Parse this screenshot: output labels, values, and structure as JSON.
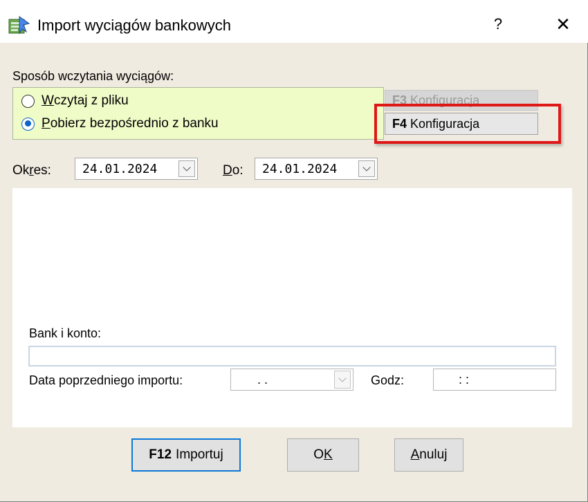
{
  "window": {
    "title": "Import wyciągów bankowych",
    "help_glyph": "?",
    "close_glyph": "✕"
  },
  "mode": {
    "section_label": "Sposób wczytania wyciągów:",
    "options": [
      {
        "accel": "W",
        "rest": "czytaj z pliku",
        "checked": false
      },
      {
        "accel": "P",
        "rest": "obierz bezpośrednio z banku",
        "checked": true
      }
    ]
  },
  "config_buttons": [
    {
      "key": "F3",
      "label": "Konfiguracja",
      "enabled": false
    },
    {
      "key": "F4",
      "label": "Konfiguracja",
      "enabled": true
    }
  ],
  "period": {
    "from_label_pre": "Ok",
    "from_label_accel": "r",
    "from_label_post": "es:",
    "from_value": "24.01.2024",
    "to_label_accel": "D",
    "to_label_post": "o:",
    "to_value": "24.01.2024"
  },
  "bank": {
    "account_label": "Bank i konto:",
    "account_value": "",
    "prev_import_label": "Data poprzedniego importu:",
    "prev_import_value": ".     .",
    "time_label": "Godz:",
    "time_value": ":     :"
  },
  "buttons": {
    "import_key": "F12",
    "import_label": "Importuj",
    "ok_accel_pre": "O",
    "ok_accel": "K",
    "cancel_accel": "A",
    "cancel_rest": "nuluj"
  },
  "colors": {
    "panel_green": "#f0fcc8",
    "highlight_red": "#e01717",
    "dialog_bg": "#f0ebe0",
    "default_button_border": "#0a78d7"
  }
}
